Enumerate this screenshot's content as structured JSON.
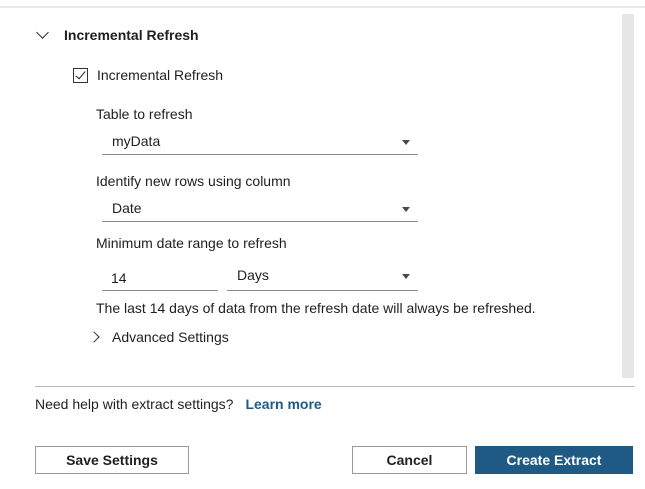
{
  "section": {
    "title": "Incremental Refresh"
  },
  "incremental_checkbox": {
    "label": "Incremental Refresh",
    "checked": true
  },
  "table_to_refresh": {
    "label": "Table to refresh",
    "value": "myData"
  },
  "identify_column": {
    "label": "Identify new rows using column",
    "value": "Date"
  },
  "min_range": {
    "label": "Minimum date range to refresh",
    "amount": "14",
    "unit": "Days"
  },
  "info_text": "The last 14 days of data from the refresh date will always be refreshed.",
  "advanced": {
    "label": "Advanced Settings"
  },
  "help": {
    "text": "Need help with extract settings?",
    "link": "Learn more"
  },
  "buttons": {
    "save": "Save Settings",
    "cancel": "Cancel",
    "create": "Create Extract"
  },
  "colors": {
    "accent": "#1f5a85"
  }
}
